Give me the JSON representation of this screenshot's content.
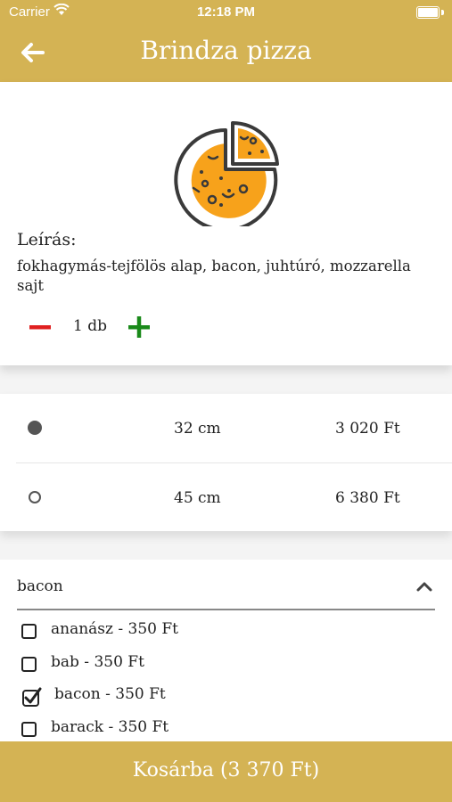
{
  "status_bar": {
    "carrier": "Carrier",
    "time": "12:18 PM"
  },
  "header": {
    "title": "Brindza pizza",
    "back_icon": "arrow-left-icon"
  },
  "product": {
    "image_icon": "pizza-icon",
    "description_label": "Leírás:",
    "description": "fokhagymás-tejfölös alap, bacon, juhtúró, mozzarella sajt",
    "quantity": "1 db"
  },
  "sizes": [
    {
      "size": "32 cm",
      "price": "3 020 Ft",
      "selected": true
    },
    {
      "size": "45 cm",
      "price": "6 380 Ft",
      "selected": false
    }
  ],
  "extras": {
    "selected_value": "bacon",
    "options": [
      {
        "label": "ananász - 350 Ft",
        "checked": false
      },
      {
        "label": "bab - 350 Ft",
        "checked": false
      },
      {
        "label": "bacon - 350 Ft",
        "checked": true
      },
      {
        "label": "barack - 350 Ft",
        "checked": false
      }
    ]
  },
  "footer": {
    "button_label": "Kosárba (3 370 Ft)"
  },
  "colors": {
    "accent": "#d4b354",
    "minus": "#e02020",
    "plus": "#1a8a1a",
    "pizza": "#f7a21b"
  }
}
